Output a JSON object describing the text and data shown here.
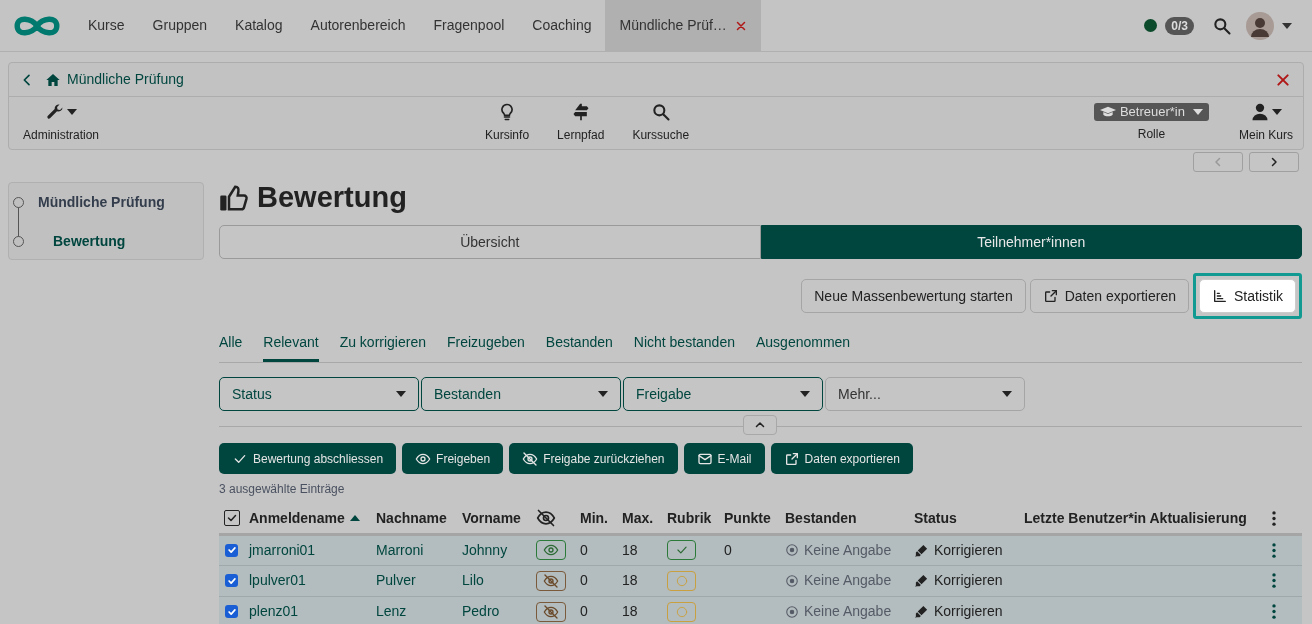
{
  "topnav": {
    "items": [
      {
        "label": "Kurse",
        "selected": false
      },
      {
        "label": "Gruppen",
        "selected": false
      },
      {
        "label": "Katalog",
        "selected": false
      },
      {
        "label": "Autorenbereich",
        "selected": false
      },
      {
        "label": "Fragenpool",
        "selected": false
      },
      {
        "label": "Coaching",
        "selected": false
      },
      {
        "label": "Mündliche Prüf…",
        "selected": true,
        "closable": true
      }
    ],
    "online": true,
    "badge": "0/3"
  },
  "course": {
    "title": "Mündliche Prüfung",
    "tools": [
      {
        "label": "Administration",
        "kind": "wrench"
      },
      {
        "label": "Kursinfo",
        "kind": "bulb"
      },
      {
        "label": "Lernpfad",
        "kind": "signpost"
      },
      {
        "label": "Kurssuche",
        "kind": "search"
      }
    ],
    "role_value": "Betreuer*in",
    "role_label": "Rolle",
    "mycourse": "Mein Kurs"
  },
  "sidebar": {
    "items": [
      {
        "label": "Mündliche Prüfung",
        "selected": false
      },
      {
        "label": "Bewertung",
        "selected": true
      }
    ]
  },
  "page_title": "Bewertung",
  "segments": [
    {
      "label": "Übersicht",
      "selected": false
    },
    {
      "label": "Teilnehmer*innen",
      "selected": true
    }
  ],
  "actions": [
    {
      "label": "Neue Massenbewertung starten",
      "kind": "plain",
      "highlighted": false
    },
    {
      "label": "Daten exportieren",
      "kind": "export",
      "highlighted": false
    },
    {
      "label": "Statistik",
      "kind": "chart",
      "highlighted": true
    }
  ],
  "filter_tabs": [
    {
      "label": "Alle",
      "selected": false
    },
    {
      "label": "Relevant",
      "selected": true
    },
    {
      "label": "Zu korrigieren",
      "selected": false
    },
    {
      "label": "Freizugeben",
      "selected": false
    },
    {
      "label": "Bestanden",
      "selected": false
    },
    {
      "label": "Nicht bestanden",
      "selected": false
    },
    {
      "label": "Ausgenommen",
      "selected": false
    }
  ],
  "filters": [
    {
      "label": "Status",
      "active": true
    },
    {
      "label": "Bestanden",
      "active": true
    },
    {
      "label": "Freigabe",
      "active": true
    },
    {
      "label": "Mehr...",
      "active": false
    }
  ],
  "bulk_actions": [
    {
      "label": "Bewertung abschliessen",
      "kind": "check"
    },
    {
      "label": "Freigeben",
      "kind": "eye"
    },
    {
      "label": "Freigabe zurückziehen",
      "kind": "eye-off"
    },
    {
      "label": "E-Mail",
      "kind": "mail"
    },
    {
      "label": "Daten exportieren",
      "kind": "export"
    }
  ],
  "selection_info": "3 ausgewählte Einträge",
  "table": {
    "all_checked": true,
    "columns": [
      "Anmeldename",
      "Nachname",
      "Vorname",
      "Min.",
      "Max.",
      "Rubrik",
      "Punkte",
      "Bestanden",
      "Status",
      "Letzte Benutzer*in Aktualisierung"
    ],
    "rows": [
      {
        "checked": true,
        "login": "jmarroni01",
        "lastname": "Marroni",
        "firstname": "Johnny",
        "visible": true,
        "min": "0",
        "max": "18",
        "rubric_done": true,
        "points": "0",
        "passed": "Keine Angabe",
        "status": "Korrigieren"
      },
      {
        "checked": true,
        "login": "lpulver01",
        "lastname": "Pulver",
        "firstname": "Lilo",
        "visible": false,
        "min": "0",
        "max": "18",
        "rubric_done": false,
        "passed": "Keine Angabe",
        "status": "Korrigieren"
      },
      {
        "checked": true,
        "login": "plenz01",
        "lastname": "Lenz",
        "firstname": "Pedro",
        "visible": false,
        "min": "0",
        "max": "18",
        "rubric_done": false,
        "passed": "Keine Angabe",
        "status": "Korrigieren"
      }
    ]
  }
}
